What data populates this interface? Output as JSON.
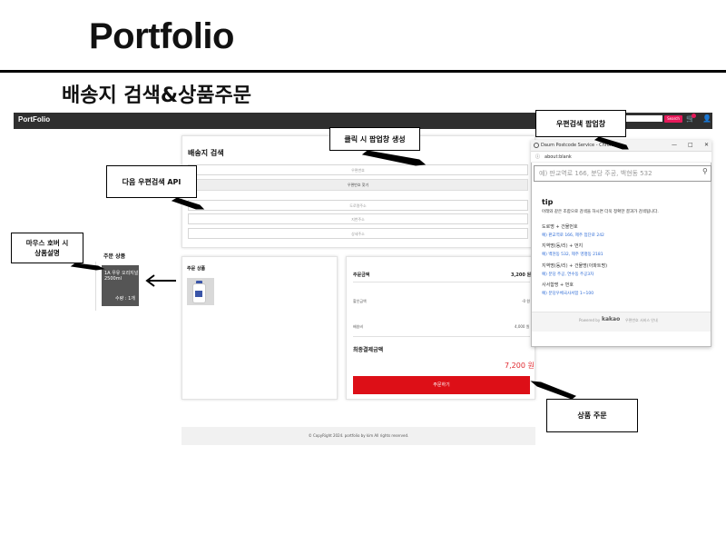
{
  "slide": {
    "title": "Portfolio",
    "section_title": "배송지 검색&상품주문"
  },
  "site": {
    "brand": "PortFolio",
    "search_button": "Search",
    "cart_icon": "cart-icon",
    "user_icon": "user-icon"
  },
  "shipping": {
    "heading": "배송지 검색",
    "zipcode_placeholder": "우편번호",
    "find_zip_button": "우편번호 찾기",
    "road_address_placeholder": "도로명주소",
    "jibun_address_placeholder": "지번주소",
    "detail_address_placeholder": "상세주소"
  },
  "order_items": {
    "label": "주문 상품"
  },
  "summary": {
    "amount_label": "주문금액",
    "amount_value": "3,200 원",
    "discount_label": "할인금액",
    "discount_value": "-0 원",
    "shipping_label": "배송비",
    "shipping_value": "4,000 원",
    "total_label": "최종결제금액",
    "total_value": "7,200 원",
    "order_button": "주문하기"
  },
  "footer": {
    "copyright": "© CopyRight 2024. portfolio by kim All rights reserved."
  },
  "side": {
    "label": "주문 상품",
    "hover_text": "1A 우유 오리지널 2500ml",
    "hover_qty": "수량 : 1개"
  },
  "popup": {
    "window_title": "Daum Postcode Service - Chrome",
    "url": "about:blank",
    "search_placeholder": "예) 판교역로 166, 분당 주공, 백현동 532",
    "tip_title": "tip",
    "tip_desc": "아래와 같은 조합으로 검색을 하시면 더욱 정확한 결과가 검색됩니다.",
    "tips": [
      {
        "head": "도로명 + 건물번호",
        "example": "예) 판교역로 166,  제주 첨단로 242"
      },
      {
        "head": "지역명(동/리) + 번지",
        "example": "예) 백현동 532,  제주 영평동 2181"
      },
      {
        "head": "지역명(동/리) + 건물명(아파트명)",
        "example": "예) 분당 주공,  연수동 주공3차"
      },
      {
        "head": "사서함명 + 번호",
        "example": "예) 분당우체국사서함 1~100"
      }
    ],
    "powered_by": "Powered by",
    "kakao": "kakao",
    "service_info": "우편번호 서비스 안내",
    "minimize": "—",
    "maximize": "□",
    "close": "✕",
    "info_icon": "ⓘ",
    "search_icon": "⚲"
  },
  "callouts": {
    "click_popup": "클릭 시 팝업창 생성",
    "next_api": "다음 우편검색 API",
    "postcode_popup": "우편검색 팝업창",
    "hover_line1": "마우스 호버 시",
    "hover_line2": "상품설명",
    "product_order": "상품 주문"
  }
}
